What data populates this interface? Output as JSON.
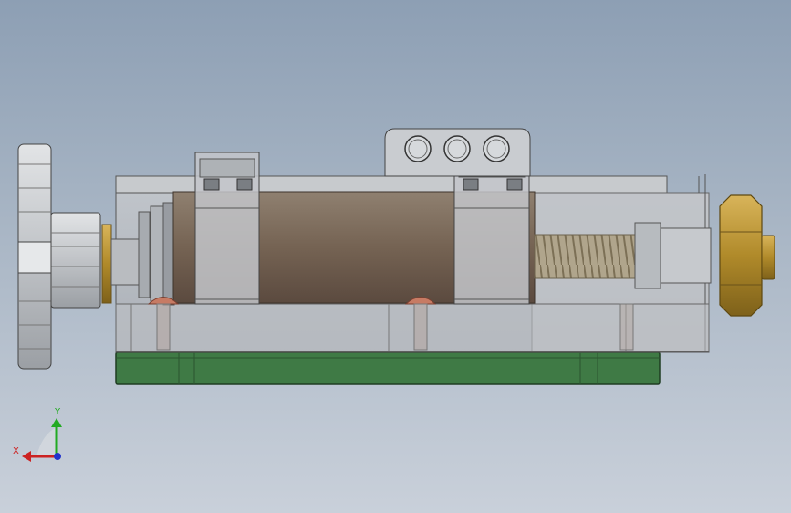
{
  "triad": {
    "y_label": "Y",
    "x_label": "X",
    "y_color": "#22aa22",
    "x_color": "#cc2222",
    "z_color": "#2233cc"
  },
  "model": {
    "colors": {
      "housing": "#b8bcc2",
      "base_plate": "#3f7a45",
      "cylinder": "#7d6a5c",
      "brass": "#b08a2a",
      "knob": "#c9ccd0",
      "spring": "#9a8a6e",
      "pin": "#c77b64"
    },
    "icons": [
      "hand-knob-icon",
      "hex-nut-icon",
      "mounting-bracket-icon",
      "coordinate-triad-icon"
    ]
  }
}
